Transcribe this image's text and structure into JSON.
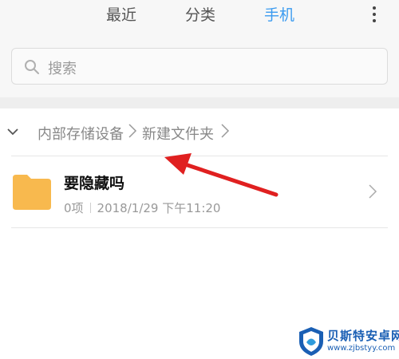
{
  "tabs": {
    "recent": "最近",
    "category": "分类",
    "phone": "手机"
  },
  "search": {
    "placeholder": "搜索"
  },
  "breadcrumb": {
    "items": [
      "内部存储设备",
      "新建文件夹"
    ]
  },
  "folder": {
    "name": "要隐藏吗",
    "count": "0项",
    "modified": "2018/1/29 下午11:20"
  },
  "watermark": {
    "title": "贝斯特安卓网",
    "url": "www.zjbstyy.com"
  },
  "colors": {
    "accent": "#3b9bf0",
    "folder": "#f8b94e",
    "annotation": "#e02020"
  },
  "icons": {
    "more": "more-vertical-icon",
    "search": "search-icon",
    "collapse": "chevron-down-icon",
    "separator": "chevron-right-icon",
    "folder": "folder-icon"
  }
}
